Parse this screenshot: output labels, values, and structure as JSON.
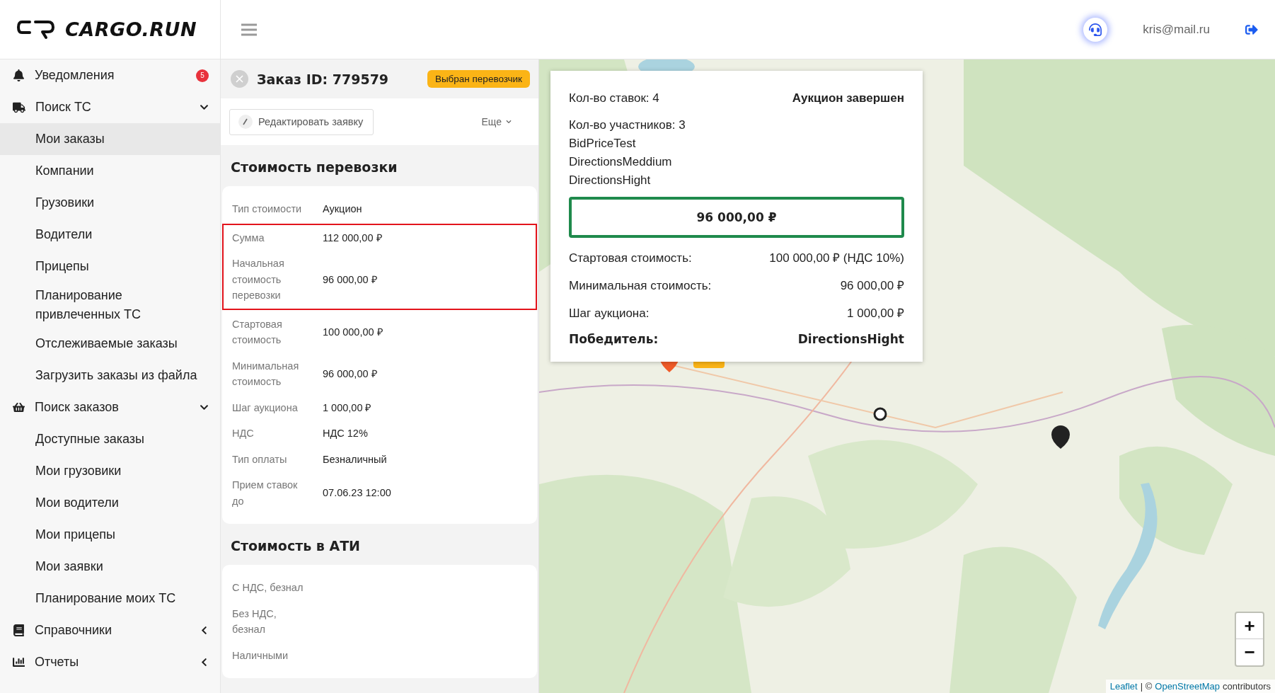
{
  "header": {
    "logo_text": "CARGO.RUN",
    "user_email": "kris@mail.ru"
  },
  "sidebar": {
    "items": [
      {
        "label": "Уведомления",
        "badge": "5"
      },
      {
        "label": "Поиск ТС",
        "expanded": true,
        "children": [
          {
            "label": "Мои заказы",
            "selected": true
          },
          {
            "label": "Компании",
            "selected": false
          },
          {
            "label": "Грузовики",
            "selected": false
          },
          {
            "label": "Водители",
            "selected": false
          },
          {
            "label": "Прицепы",
            "selected": false
          },
          {
            "label": "Планирование привлеченных ТС",
            "selected": false
          },
          {
            "label": "Отслеживаемые заказы",
            "selected": false
          },
          {
            "label": "Загрузить заказы из файла",
            "selected": false
          }
        ]
      },
      {
        "label": "Поиск заказов",
        "expanded": true,
        "children": [
          {
            "label": "Доступные заказы",
            "selected": false
          },
          {
            "label": "Мои грузовики",
            "selected": false
          },
          {
            "label": "Мои водители",
            "selected": false
          },
          {
            "label": "Мои прицепы",
            "selected": false
          },
          {
            "label": "Мои заявки",
            "selected": false
          },
          {
            "label": "Планирование моих ТС",
            "selected": false
          }
        ]
      },
      {
        "label": "Справочники",
        "expanded": false
      },
      {
        "label": "Отчеты",
        "expanded": false
      }
    ]
  },
  "order": {
    "title": "Заказ ID: 779579",
    "status": "Выбран перевозчик",
    "edit_button": "Редактировать заявку",
    "more_menu": "Еще",
    "sections": [
      {
        "title": "Стоимость перевозки",
        "rows": [
          {
            "label": "Тип стоимости",
            "value": "Аукцион",
            "highlighted": false
          },
          {
            "label": "Сумма",
            "value": "112 000,00 ₽",
            "highlighted": true
          },
          {
            "label": "Начальная стоимость перевозки",
            "value": "96 000,00 ₽",
            "highlighted": true
          },
          {
            "label": "Стартовая стоимость",
            "value": "100 000,00 ₽",
            "highlighted": false
          },
          {
            "label": "Минимальная стоимость",
            "value": "96 000,00 ₽",
            "highlighted": false
          },
          {
            "label": "Шаг аукциона",
            "value": "1 000,00 ₽",
            "highlighted": false
          },
          {
            "label": "НДС",
            "value": "НДС 12%",
            "highlighted": false
          },
          {
            "label": "Тип оплаты",
            "value": "Безналичный",
            "highlighted": false
          },
          {
            "label": "Прием ставок до",
            "value": "07.06.23 12:00",
            "highlighted": false
          }
        ]
      },
      {
        "title": "Стоимость в АТИ",
        "rows": [
          {
            "label": "С НДС, безнал",
            "highlighted": false
          },
          {
            "label": "Без НДС, безнал",
            "highlighted": false
          },
          {
            "label": "Наличными",
            "highlighted": false
          }
        ]
      }
    ]
  },
  "map": {
    "kind": "picture",
    "zoom_in": "+",
    "zoom_out": "−",
    "attribution": {
      "leaflet": "Leaflet",
      "separator": "| ©",
      "osm": "OpenStreetMap",
      "suffix": "contributors"
    },
    "popup": {
      "bids": "Кол-во ставок: 4",
      "status": "Аукцион завершен",
      "participants_label": "Кол-во участников: 3",
      "participants": [
        "BidPriceTest",
        "DirectionsMeddium",
        "DirectionsHight"
      ],
      "winning_price": "96 000,00 ₽",
      "details": [
        {
          "label": "Стартовая стоимость:",
          "value": "100 000,00 ₽ (НДС 10%)"
        },
        {
          "label": "Минимальная стоимость:",
          "value": "96 000,00 ₽"
        },
        {
          "label": "Шаг аукциона:",
          "value": "1 000,00 ₽"
        }
      ],
      "winner": {
        "label": "Победитель:",
        "value": "DirectionsHight"
      }
    }
  }
}
